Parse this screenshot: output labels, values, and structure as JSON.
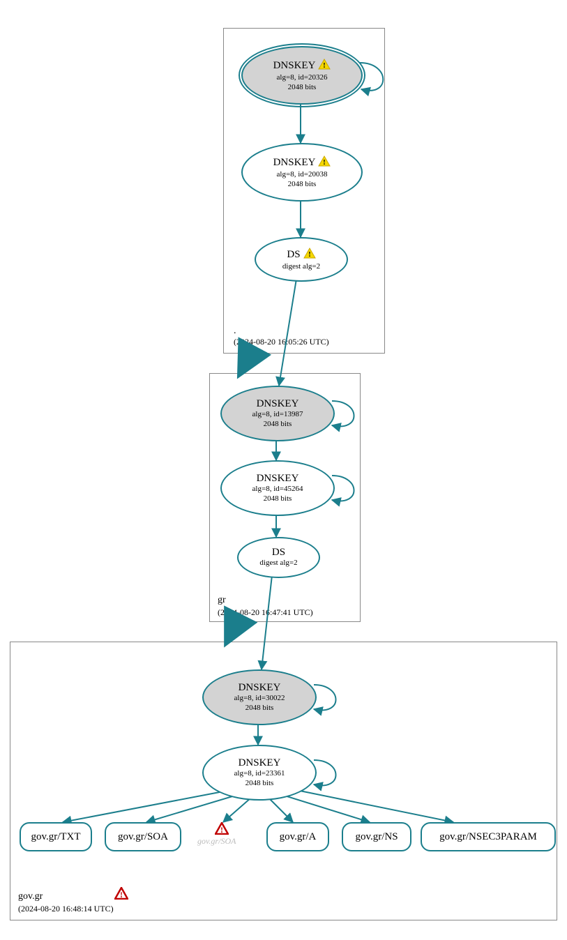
{
  "zones": {
    "root": {
      "label": ".",
      "time": "(2024-08-20 16:05:26 UTC)",
      "dnskey1": {
        "title": "DNSKEY",
        "alg": "alg=8, id=20326",
        "bits": "2048 bits",
        "warn": true
      },
      "dnskey2": {
        "title": "DNSKEY",
        "alg": "alg=8, id=20038",
        "bits": "2048 bits",
        "warn": true
      },
      "ds": {
        "title": "DS",
        "alg": "digest alg=2",
        "warn": true
      }
    },
    "gr": {
      "label": "gr",
      "time": "(2024-08-20 16:47:41 UTC)",
      "dnskey1": {
        "title": "DNSKEY",
        "alg": "alg=8, id=13987",
        "bits": "2048 bits"
      },
      "dnskey2": {
        "title": "DNSKEY",
        "alg": "alg=8, id=45264",
        "bits": "2048 bits"
      },
      "ds": {
        "title": "DS",
        "alg": "digest alg=2"
      }
    },
    "govgr": {
      "label": "gov.gr",
      "time": "(2024-08-20 16:48:14 UTC)",
      "dnskey1": {
        "title": "DNSKEY",
        "alg": "alg=8, id=30022",
        "bits": "2048 bits"
      },
      "dnskey2": {
        "title": "DNSKEY",
        "alg": "alg=8, id=23361",
        "bits": "2048 bits"
      },
      "rrsets": {
        "txt": "gov.gr/TXT",
        "soa": "gov.gr/SOA",
        "soa_ghost": "gov.gr/SOA",
        "a": "gov.gr/A",
        "ns": "gov.gr/NS",
        "nsec3": "gov.gr/NSEC3PARAM"
      }
    }
  }
}
